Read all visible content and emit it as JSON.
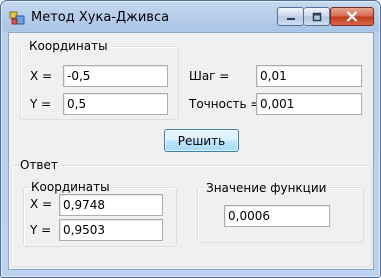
{
  "window": {
    "title": "Метод Хука-Дживса"
  },
  "input_group": {
    "title": "Координаты",
    "x_label": "X =",
    "x_value": "-0,5",
    "y_label": "Y =",
    "y_value": "0,5",
    "step_label": "Шаг =",
    "step_value": "0,01",
    "precision_label": "Точность =",
    "precision_value": "0,001"
  },
  "solve_button": "Решить",
  "answer_group": {
    "title": "Ответ",
    "coords_title": "Координаты",
    "x_label": "X =",
    "x_value": "0,9748",
    "y_label": "Y =",
    "y_value": "0,9503",
    "func_title": "Значение функции",
    "func_value": "0,0006"
  }
}
